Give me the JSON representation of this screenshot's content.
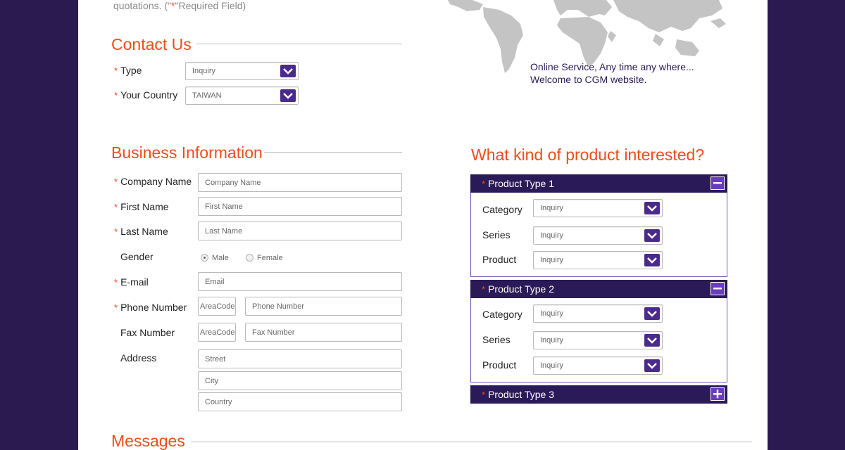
{
  "intro": {
    "text_before": "quotations. (\"",
    "star": "*",
    "text_after": "\"Required Field)"
  },
  "map": {
    "line1": "Online Service, Any time any where...",
    "line2": "Welcome to CGM website."
  },
  "contact": {
    "title": "Contact Us",
    "type_label": "Type",
    "type_value": "Inquiry",
    "country_label": "Your Country",
    "country_value": "TAIWAN"
  },
  "business": {
    "title": "Business Information",
    "company_label": "Company Name",
    "company_placeholder": "Company Name",
    "first_label": "First Name",
    "first_placeholder": "First Name",
    "last_label": "Last Name",
    "last_placeholder": "Last Name",
    "gender_label": "Gender",
    "gender_male": "Male",
    "gender_female": "Female",
    "email_label": "E-mail",
    "email_placeholder": "Email",
    "phone_label": "Phone Number",
    "phone_area": "AreaCode",
    "phone_placeholder": "Phone Number",
    "fax_label": "Fax Number",
    "fax_area": "AreaCode",
    "fax_placeholder": "Fax Number",
    "address_label": "Address",
    "street_placeholder": "Street",
    "city_placeholder": "City",
    "country_placeholder": "Country"
  },
  "product": {
    "title": "What kind of product interested?",
    "types": [
      {
        "label": "Product Type 1",
        "category": "Category",
        "series": "Series",
        "product": "Product",
        "value": "Inquiry"
      },
      {
        "label": "Product Type 2",
        "category": "Category",
        "series": "Series",
        "product": "Product",
        "value": "Inquiry"
      },
      {
        "label": "Product Type 3"
      }
    ]
  },
  "messages": {
    "title": "Messages"
  },
  "colors": {
    "accent_purple": "#2b1a58",
    "button_purple": "#4a2a8a",
    "heading_orange": "#ee4c1c"
  }
}
